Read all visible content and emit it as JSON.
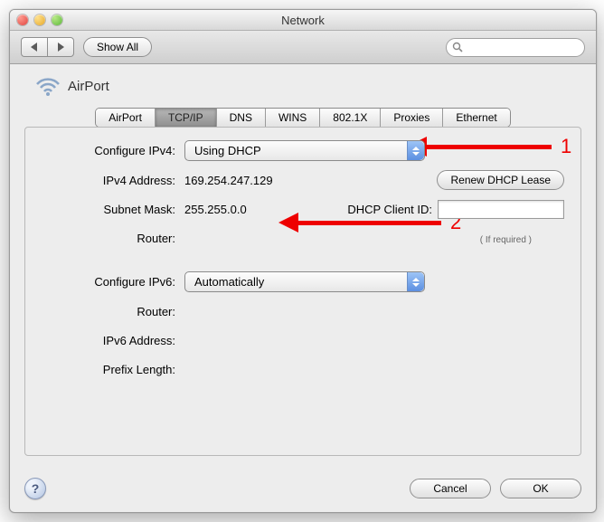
{
  "window": {
    "title": "Network"
  },
  "toolbar": {
    "back": "◀",
    "forward": "▶",
    "show_all": "Show All",
    "search_placeholder": ""
  },
  "header": {
    "title": "AirPort"
  },
  "tabs": [
    "AirPort",
    "TCP/IP",
    "DNS",
    "WINS",
    "802.1X",
    "Proxies",
    "Ethernet"
  ],
  "active_tab_index": 1,
  "form": {
    "configure_ipv4_label": "Configure IPv4:",
    "configure_ipv4_value": "Using DHCP",
    "ipv4_address_label": "IPv4 Address:",
    "ipv4_address_value": "169.254.247.129",
    "subnet_mask_label": "Subnet Mask:",
    "subnet_mask_value": "255.255.0.0",
    "router_label": "Router:",
    "router_value": "",
    "configure_ipv6_label": "Configure IPv6:",
    "configure_ipv6_value": "Automatically",
    "router6_label": "Router:",
    "router6_value": "",
    "ipv6_address_label": "IPv6 Address:",
    "ipv6_address_value": "",
    "prefix_length_label": "Prefix Length:",
    "prefix_length_value": "",
    "renew_lease": "Renew DHCP Lease",
    "dhcp_client_id_label": "DHCP Client ID:",
    "dhcp_client_id_value": "",
    "if_required": "( If required )"
  },
  "footer": {
    "help": "?",
    "cancel": "Cancel",
    "ok": "OK"
  },
  "annotations": {
    "one": "1",
    "two": "2"
  }
}
